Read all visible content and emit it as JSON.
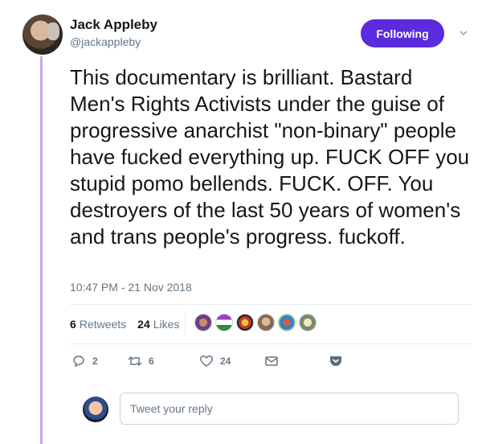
{
  "author": {
    "name": "Jack Appleby",
    "handle": "@jackappleby"
  },
  "follow_button_label": "Following",
  "tweet": {
    "text": "This documentary is brilliant. Bastard Men's Rights Activists under the guise of progressive anarchist \"non-binary\" people have fucked everything up. FUCK OFF you stupid pomo bellends. FUCK. OFF. You destroyers of the last 50 years of women's and trans people's progress. fuckoff.",
    "timestamp": "10:47 PM - 21 Nov 2018"
  },
  "stats": {
    "retweets_count": "6",
    "retweets_label": "Retweets",
    "likes_count": "24",
    "likes_label": "Likes"
  },
  "actions": {
    "reply_count": "2",
    "retweet_count": "6",
    "like_count": "24"
  },
  "reply_box": {
    "placeholder": "Tweet your reply"
  },
  "colors": {
    "follow_button": "#5b2bde",
    "thread_line": "#c9a9e3",
    "muted_text": "#657786",
    "pocket_icon": "#5b6b7d"
  }
}
